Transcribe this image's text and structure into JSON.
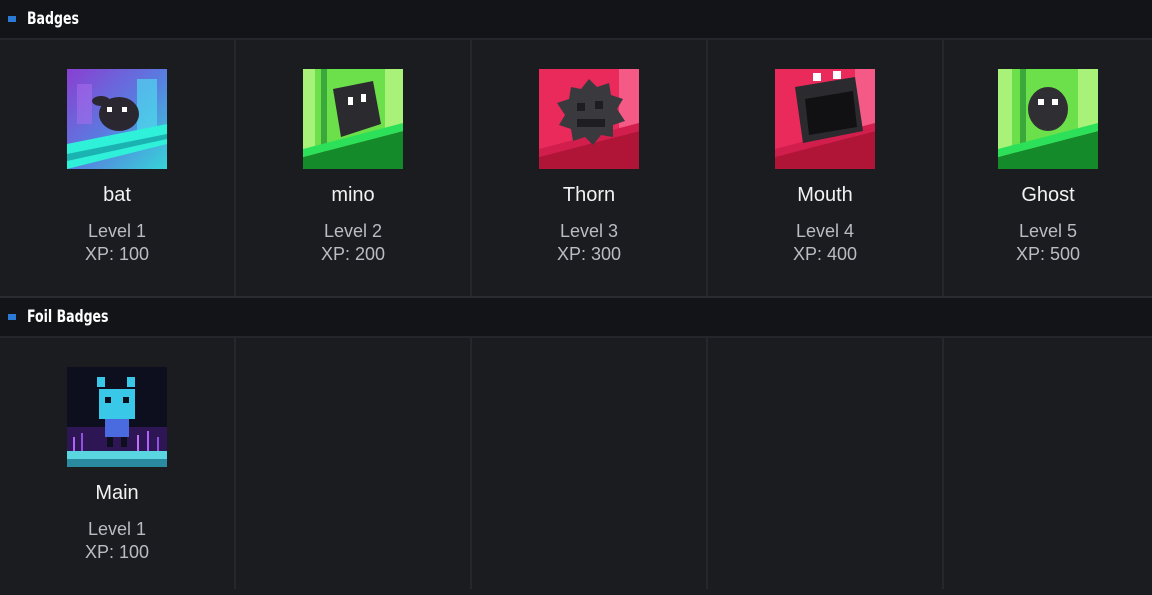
{
  "sections": [
    {
      "title": "Badges",
      "badges": [
        {
          "name": "bat",
          "level": "Level 1",
          "xp": "XP: 100",
          "icon": "bat-badge-icon"
        },
        {
          "name": "mino",
          "level": "Level 2",
          "xp": "XP: 200",
          "icon": "mino-badge-icon"
        },
        {
          "name": "Thorn",
          "level": "Level 3",
          "xp": "XP: 300",
          "icon": "thorn-badge-icon"
        },
        {
          "name": "Mouth",
          "level": "Level 4",
          "xp": "XP: 400",
          "icon": "mouth-badge-icon"
        },
        {
          "name": "Ghost",
          "level": "Level 5",
          "xp": "XP: 500",
          "icon": "ghost-badge-icon"
        }
      ]
    },
    {
      "title": "Foil Badges",
      "badges": [
        {
          "name": "Main",
          "level": "Level 1",
          "xp": "XP: 100",
          "icon": "main-foil-badge-icon"
        }
      ]
    }
  ],
  "colors": {
    "accent": "#2b7bd6",
    "background": "#1b1c20",
    "header": "#131417"
  }
}
